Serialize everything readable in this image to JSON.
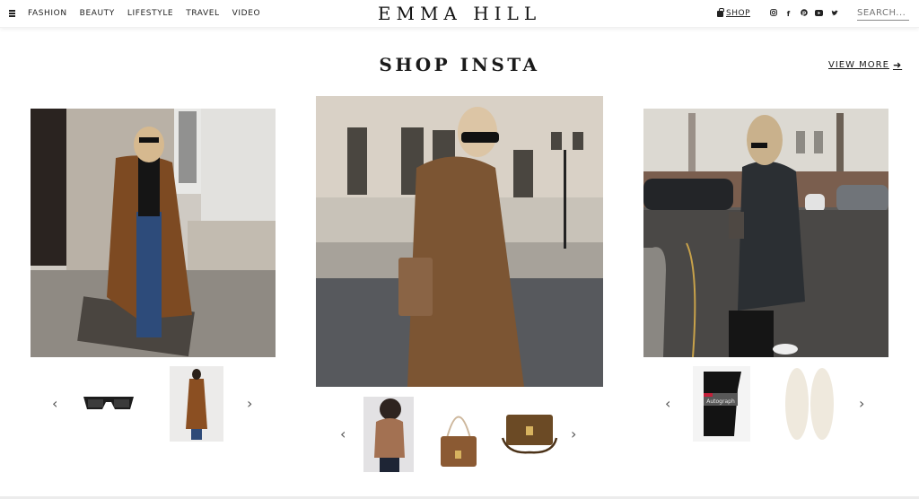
{
  "header": {
    "menu_icon": "hamburger-menu-icon",
    "nav": [
      "FASHION",
      "BEAUTY",
      "LIFESTYLE",
      "TRAVEL",
      "VIDEO"
    ],
    "logo": "EMMA HILL",
    "shop_label": "SHOP",
    "shop_icon": "shopping-bag-icon",
    "social_icons": [
      "instagram-icon",
      "facebook-icon",
      "pinterest-icon",
      "youtube-icon",
      "twitter-icon"
    ],
    "search_placeholder": "SEARCH..."
  },
  "section": {
    "title": "SHOP INSTA",
    "view_more_label": "VIEW MORE",
    "view_more_icon": "arrow-right-icon"
  },
  "posts": [
    {
      "photo": "Woman in long camel wrap coat and blue jeans walking by stone building",
      "products": [
        {
          "name": "Black rectangular sunglasses"
        },
        {
          "name": "Camel belted long coat"
        }
      ]
    },
    {
      "photo": "Woman in belted camel coat with brown shoulder bag on London street",
      "products": [
        {
          "name": "Camel knit sweater"
        },
        {
          "name": "Brown leather shoulder bag"
        },
        {
          "name": "Brown box crossbody bag"
        }
      ]
    },
    {
      "photo": "Woman in charcoal coat crossing street with cars behind",
      "products": [
        {
          "name": "Autograph black socks",
          "label": "Autograph"
        },
        {
          "name": "Shearling insoles"
        }
      ]
    }
  ],
  "colors": {
    "text": "#1a1a1a",
    "camel": "#8a5a34",
    "charcoal": "#2b2f33"
  }
}
